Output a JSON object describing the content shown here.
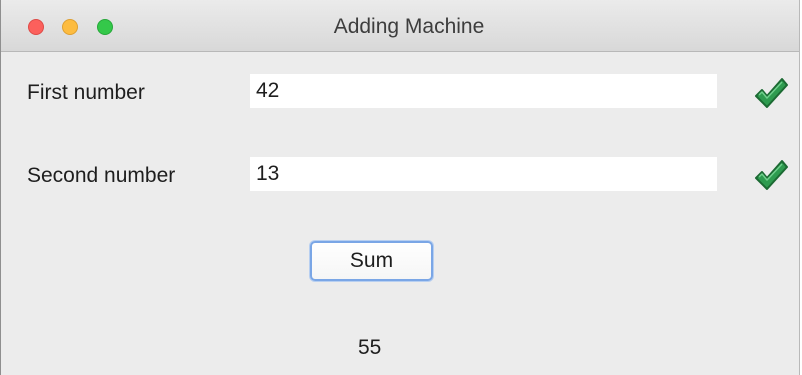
{
  "window": {
    "title": "Adding Machine"
  },
  "form": {
    "first_label": "First number",
    "first_value": "42",
    "second_label": "Second number",
    "second_value": "13",
    "sum_button_label": "Sum",
    "result": "55"
  },
  "icons": {
    "first_status": "checkmark-icon",
    "second_status": "checkmark-icon"
  },
  "colors": {
    "checkmark": "#2e9b4f",
    "button_focus_ring": "#7aa6e6"
  }
}
